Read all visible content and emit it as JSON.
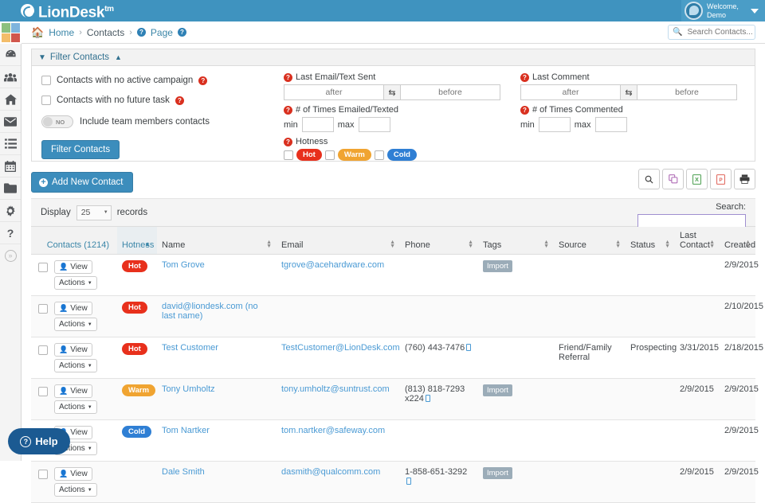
{
  "app": {
    "brand": "LionDesk",
    "brand_sup": "tm",
    "user_line1": "Welcome,",
    "user_line2": "Demo"
  },
  "header": {
    "search_placeholder": "Search Contacts...",
    "search_value": ""
  },
  "breadcrumb": {
    "home": "Home",
    "contacts": "Contacts",
    "page": "Page",
    "sep": "›"
  },
  "sidebar": {
    "items": [
      {
        "name": "dashboard",
        "label": "Dashboard"
      },
      {
        "name": "contacts",
        "label": "Contacts"
      },
      {
        "name": "properties",
        "label": "Properties"
      },
      {
        "name": "email",
        "label": "Email"
      },
      {
        "name": "tasks",
        "label": "Tasks"
      },
      {
        "name": "calendar",
        "label": "Calendar"
      },
      {
        "name": "files",
        "label": "Files"
      },
      {
        "name": "settings",
        "label": "Settings"
      },
      {
        "name": "help",
        "label": "Help"
      }
    ],
    "collapse_label": "»"
  },
  "filter": {
    "title": "Filter Contacts",
    "checkbox_no_campaign": "Contacts with no active campaign",
    "checkbox_no_future_task": "Contacts with no future task",
    "toggle_label": "Include team members contacts",
    "toggle_state": "NO",
    "submit_label": "Filter Contacts",
    "last_email_label": "Last Email/Text Sent",
    "last_comment_label": "Last Comment",
    "times_emailed_label": "# of Times Emailed/Texted",
    "times_commented_label": "# of Times Commented",
    "hotness_label": "Hotness",
    "after_placeholder": "after",
    "before_placeholder": "before",
    "min_label": "min",
    "max_label": "max",
    "min_value": "",
    "max_value": "",
    "hotness_options": [
      {
        "label": "Hot",
        "color": "#e8301c",
        "checked": false
      },
      {
        "label": "Warm",
        "color": "#f0a431",
        "checked": false
      },
      {
        "label": "Cold",
        "color": "#2f7fd4",
        "checked": false
      }
    ]
  },
  "actions": {
    "add_contact": "Add New Contact",
    "tools": [
      {
        "name": "column-search",
        "glyph": "search"
      },
      {
        "name": "copy",
        "glyph": "copy"
      },
      {
        "name": "export-excel",
        "glyph": "excel"
      },
      {
        "name": "export-pdf",
        "glyph": "pdf"
      },
      {
        "name": "print",
        "glyph": "print"
      }
    ]
  },
  "table_controls": {
    "display_label": "Display",
    "records_label": "records",
    "page_size": "25",
    "search_label": "Search:",
    "search_value": ""
  },
  "table": {
    "columns": [
      {
        "key": "contacts",
        "label": "Contacts (1214)",
        "sortable": true,
        "active": false
      },
      {
        "key": "hotness",
        "label": "Hotness",
        "sortable": true,
        "active": true,
        "direction": "asc"
      },
      {
        "key": "name",
        "label": "Name",
        "sortable": true,
        "active": false
      },
      {
        "key": "email",
        "label": "Email",
        "sortable": true,
        "active": false
      },
      {
        "key": "phone",
        "label": "Phone",
        "sortable": true,
        "active": false
      },
      {
        "key": "tags",
        "label": "Tags",
        "sortable": true,
        "active": false
      },
      {
        "key": "source",
        "label": "Source",
        "sortable": true,
        "active": false
      },
      {
        "key": "status",
        "label": "Status",
        "sortable": true,
        "active": false
      },
      {
        "key": "last_contact",
        "label": "Last Contact",
        "sortable": true,
        "active": false
      },
      {
        "key": "created",
        "label": "Created",
        "sortable": true,
        "active": false
      }
    ],
    "row_buttons": {
      "view": "View",
      "actions": "Actions"
    },
    "rows": [
      {
        "hotness": "Hot",
        "hotness_color": "#e8301c",
        "name": "Tom Grove",
        "email": "tgrove@acehardware.com",
        "phone": "",
        "phone_sms": false,
        "tags": "Import",
        "source": "",
        "status": "",
        "last_contact": "",
        "created": "2/9/2015"
      },
      {
        "hotness": "Hot",
        "hotness_color": "#e8301c",
        "name": "david@liondesk.com (no last name)",
        "email": "",
        "phone": "",
        "phone_sms": false,
        "tags": "",
        "source": "",
        "status": "",
        "last_contact": "",
        "created": "2/10/2015"
      },
      {
        "hotness": "Hot",
        "hotness_color": "#e8301c",
        "name": "Test Customer",
        "email": "TestCustomer@LionDesk.com",
        "phone": "(760) 443-7476",
        "phone_sms": true,
        "tags": "",
        "source": "Friend/Family Referral",
        "status": "Prospecting",
        "last_contact": "3/31/2015",
        "created": "2/18/2015"
      },
      {
        "hotness": "Warm",
        "hotness_color": "#f0a431",
        "name": "Tony Umholtz",
        "email": "tony.umholtz@suntrust.com",
        "phone": "(813) 818-7293 x224",
        "phone_sms": true,
        "tags": "Import",
        "source": "",
        "status": "",
        "last_contact": "2/9/2015",
        "created": "2/9/2015"
      },
      {
        "hotness": "Cold",
        "hotness_color": "#2f7fd4",
        "name": "Tom Nartker",
        "email": "tom.nartker@safeway.com",
        "phone": "",
        "phone_sms": false,
        "tags": "",
        "source": "",
        "status": "",
        "last_contact": "",
        "created": "2/9/2015"
      },
      {
        "hotness": "",
        "hotness_color": "",
        "name": "Dale Smith",
        "email": "dasmith@qualcomm.com",
        "phone": "1-858-651-3292",
        "phone_sms": true,
        "tags": "Import",
        "source": "",
        "status": "",
        "last_contact": "2/9/2015",
        "created": "2/9/2015"
      }
    ]
  },
  "help_widget": {
    "label": "Help"
  },
  "colors": {
    "topbar": "#3f93bf",
    "primary_button": "#3c8dbc",
    "link": "#4a9ad4",
    "hot": "#e8301c",
    "warm": "#f0a431",
    "cold": "#2f7fd4",
    "help": "#1b5a92"
  }
}
